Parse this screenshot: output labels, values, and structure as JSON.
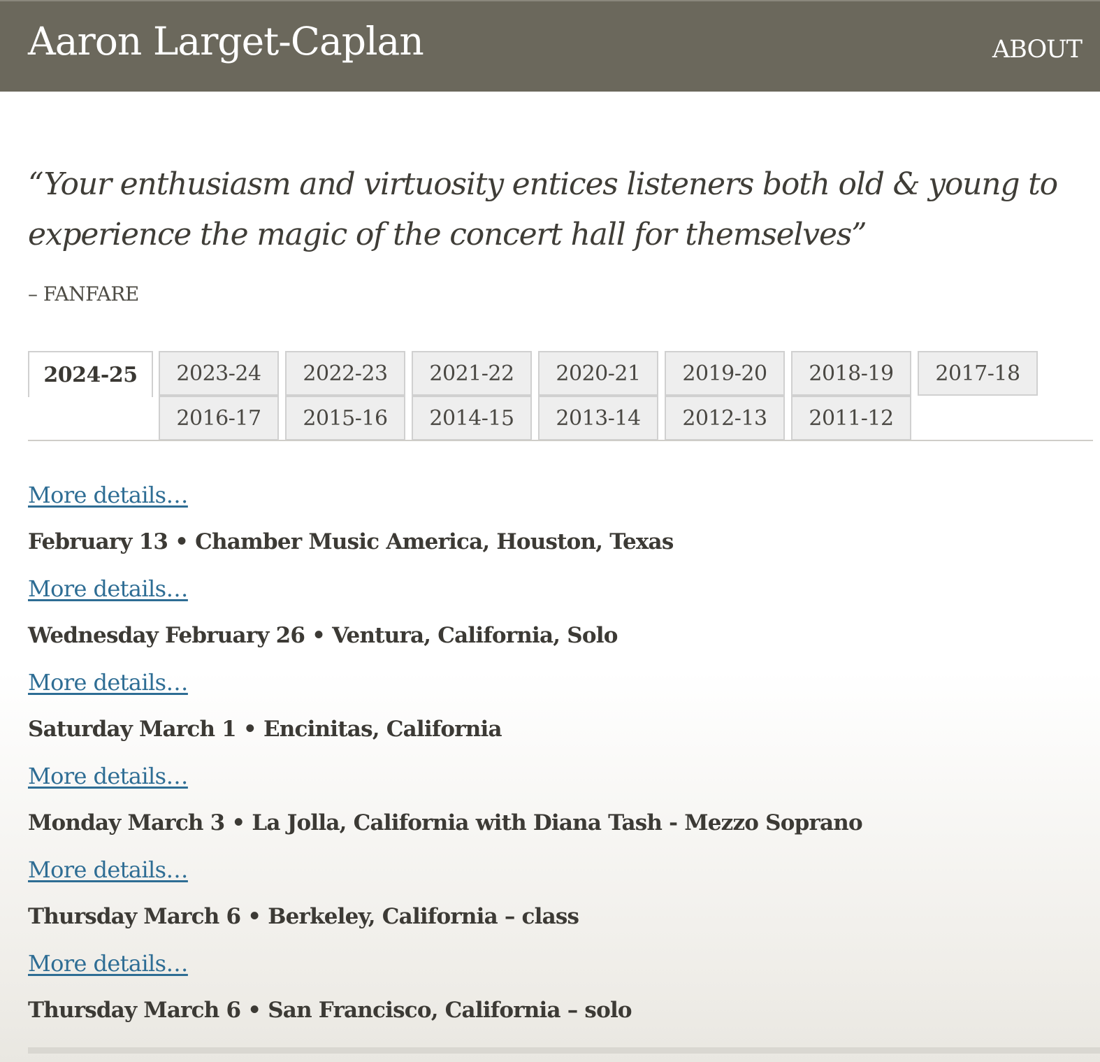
{
  "header": {
    "site_title": "Aaron Larget-Caplan",
    "nav_about": "ABOUT"
  },
  "quote": {
    "text": "“Your enthusiasm and virtuosity entices listeners both old & young to experience the magic of the concert hall for themselves”",
    "source": "– FANFARE"
  },
  "season_tabs": {
    "active": "2024-25",
    "row1": [
      "2024-25",
      "2023-24",
      "2022-23",
      "2021-22",
      "2020-21",
      "2019-20",
      "2018-19",
      "2017-18"
    ],
    "row2": [
      "2016-17",
      "2015-16",
      "2014-15",
      "2013-14",
      "2012-13",
      "2011-12"
    ]
  },
  "events": {
    "more_details_label": "More details…",
    "items": [
      "February 13 • Chamber Music America, Houston, Texas",
      "Wednesday February 26 • Ventura, California, Solo",
      "Saturday March 1 • Encinitas, California",
      "Monday March 3 • La Jolla, California with Diana Tash - Mezzo Soprano",
      "Thursday March 6 • Berkeley, California – class",
      "Thursday March 6 • San Francisco, California – solo"
    ]
  },
  "colors": {
    "header_bg": "#6b685c",
    "link": "#2e6d94",
    "text": "#3f3d37",
    "tab_bg": "#eeeeee"
  }
}
